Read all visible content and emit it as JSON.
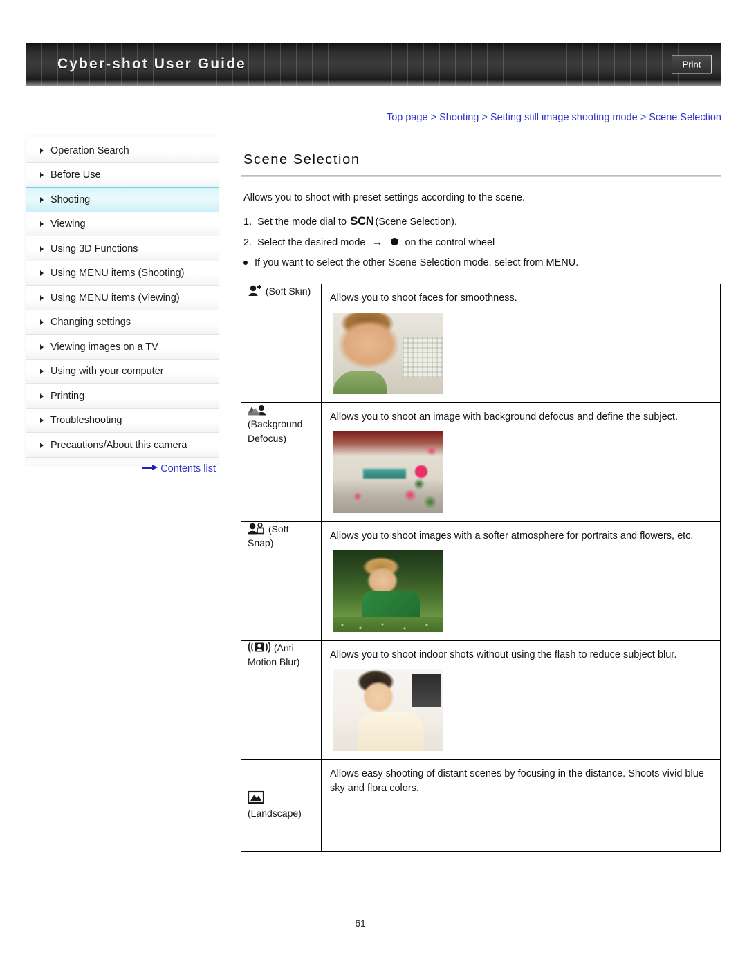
{
  "header": {
    "title": "Cyber-shot User Guide",
    "print_label": "Print"
  },
  "breadcrumb": {
    "text": "Top page > Shooting > Setting still image shooting mode > Scene Selection"
  },
  "sidebar": {
    "items": [
      {
        "label": "Operation Search",
        "active": false
      },
      {
        "label": "Before Use",
        "active": false
      },
      {
        "label": "Shooting",
        "active": true
      },
      {
        "label": "Viewing",
        "active": false
      },
      {
        "label": "Using 3D Functions",
        "active": false
      },
      {
        "label": "Using MENU items (Shooting)",
        "active": false
      },
      {
        "label": "Using MENU items (Viewing)",
        "active": false
      },
      {
        "label": "Changing settings",
        "active": false
      },
      {
        "label": "Viewing images on a TV",
        "active": false
      },
      {
        "label": "Using with your computer",
        "active": false
      },
      {
        "label": "Printing",
        "active": false
      },
      {
        "label": "Troubleshooting",
        "active": false
      },
      {
        "label": "Precautions/About this camera",
        "active": false
      }
    ],
    "contents_list_label": "Contents list"
  },
  "main": {
    "title": "Scene Selection",
    "lead": "Allows you to shoot with preset settings according to the scene.",
    "step1_num": "1.",
    "step1_pre": "Set the mode dial to",
    "step1_scn": "SCN",
    "step1_post": "(Scene Selection).",
    "step2_num": "2.",
    "step2_pre": "Select the desired mode",
    "step2_post": "on the control wheel",
    "note": "If you want to select the other Scene Selection mode, select from MENU."
  },
  "table": {
    "rows": [
      {
        "icon": "soft-skin-icon",
        "mode_label": "(Soft Skin)",
        "description": "Allows you to shoot faces for smoothness.",
        "photo": "soft-skin-sample-photo"
      },
      {
        "icon": "background-defocus-icon",
        "mode_label": "(Background Defocus)",
        "description": "Allows you to shoot an image with background defocus and define the subject.",
        "photo": "background-defocus-sample-photo"
      },
      {
        "icon": "soft-snap-icon",
        "mode_label": "(Soft Snap)",
        "description": "Allows you to shoot images with a softer atmosphere for portraits and flowers, etc.",
        "photo": "soft-snap-sample-photo"
      },
      {
        "icon": "anti-motion-blur-icon",
        "mode_label": "(Anti Motion Blur)",
        "description": "Allows you to shoot indoor shots without using the flash to reduce subject blur.",
        "photo": "anti-motion-blur-sample-photo"
      },
      {
        "icon": "landscape-icon",
        "mode_label": "(Landscape)",
        "description": "Allows easy shooting of distant scenes by focusing in the distance. Shoots vivid blue sky and flora colors.",
        "photo": ""
      }
    ]
  },
  "footer": {
    "page_number": "61"
  },
  "colors": {
    "link": "#3333cc",
    "active_sidebar": "#d8f5fb",
    "header_dark": "#2e2e2e"
  }
}
